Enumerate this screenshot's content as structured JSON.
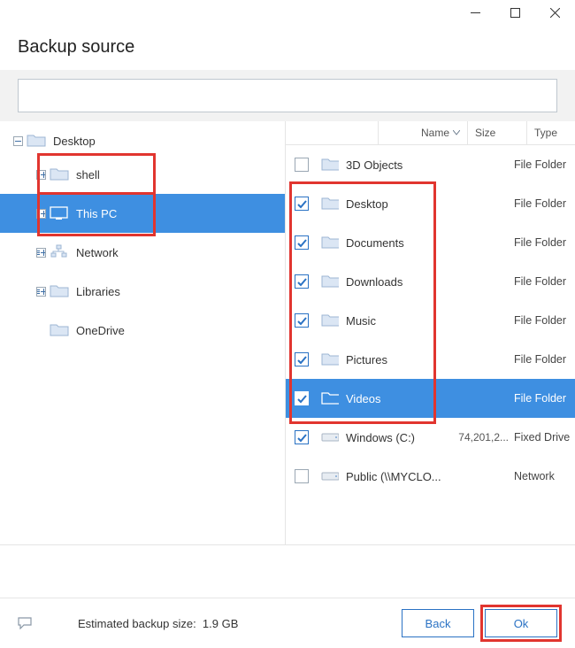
{
  "header": {
    "title": "Backup source"
  },
  "titlebar": {
    "minimize": "–",
    "maximize": "☐",
    "close": "✕"
  },
  "search": {
    "placeholder": ""
  },
  "tree": {
    "items": [
      {
        "label": "Desktop",
        "icon": "folder",
        "depth": 1,
        "exp": "minus",
        "sel": false,
        "hl": false
      },
      {
        "label": "shell",
        "icon": "folder",
        "depth": 2,
        "exp": "plus",
        "sel": false,
        "hl": true
      },
      {
        "label": "This PC",
        "icon": "monitor",
        "depth": 2,
        "exp": "plus",
        "sel": true,
        "hl": true
      },
      {
        "label": "Network",
        "icon": "network",
        "depth": 2,
        "exp": "plus",
        "sel": false,
        "hl": false
      },
      {
        "label": "Libraries",
        "icon": "folder",
        "depth": 2,
        "exp": "plus",
        "sel": false,
        "hl": false
      },
      {
        "label": "OneDrive",
        "icon": "folder",
        "depth": 2,
        "exp": "none",
        "sel": false,
        "hl": false
      }
    ]
  },
  "list": {
    "columns": {
      "name": "Name",
      "size": "Size",
      "type": "Type"
    },
    "items": [
      {
        "name": "3D Objects",
        "icon": "folder",
        "checked": false,
        "size": "",
        "type": "File Folder",
        "sel": false
      },
      {
        "name": "Desktop",
        "icon": "folder",
        "checked": true,
        "size": "",
        "type": "File Folder",
        "sel": false
      },
      {
        "name": "Documents",
        "icon": "folder",
        "checked": true,
        "size": "",
        "type": "File Folder",
        "sel": false
      },
      {
        "name": "Downloads",
        "icon": "folder",
        "checked": true,
        "size": "",
        "type": "File Folder",
        "sel": false
      },
      {
        "name": "Music",
        "icon": "folder",
        "checked": true,
        "size": "",
        "type": "File Folder",
        "sel": false
      },
      {
        "name": "Pictures",
        "icon": "folder",
        "checked": true,
        "size": "",
        "type": "File Folder",
        "sel": false
      },
      {
        "name": "Videos",
        "icon": "folder",
        "checked": true,
        "size": "",
        "type": "File Folder",
        "sel": true
      },
      {
        "name": "Windows (C:)",
        "icon": "drive",
        "checked": true,
        "size": "74,201,2...",
        "type": "Fixed Drive",
        "sel": false
      },
      {
        "name": "Public (\\\\MYCLO...",
        "icon": "drive",
        "checked": false,
        "size": "",
        "type": "Network",
        "sel": false
      }
    ]
  },
  "footer": {
    "estimate_label": "Estimated backup size:",
    "estimate_value": "1.9 GB",
    "back": "Back",
    "ok": "Ok"
  }
}
